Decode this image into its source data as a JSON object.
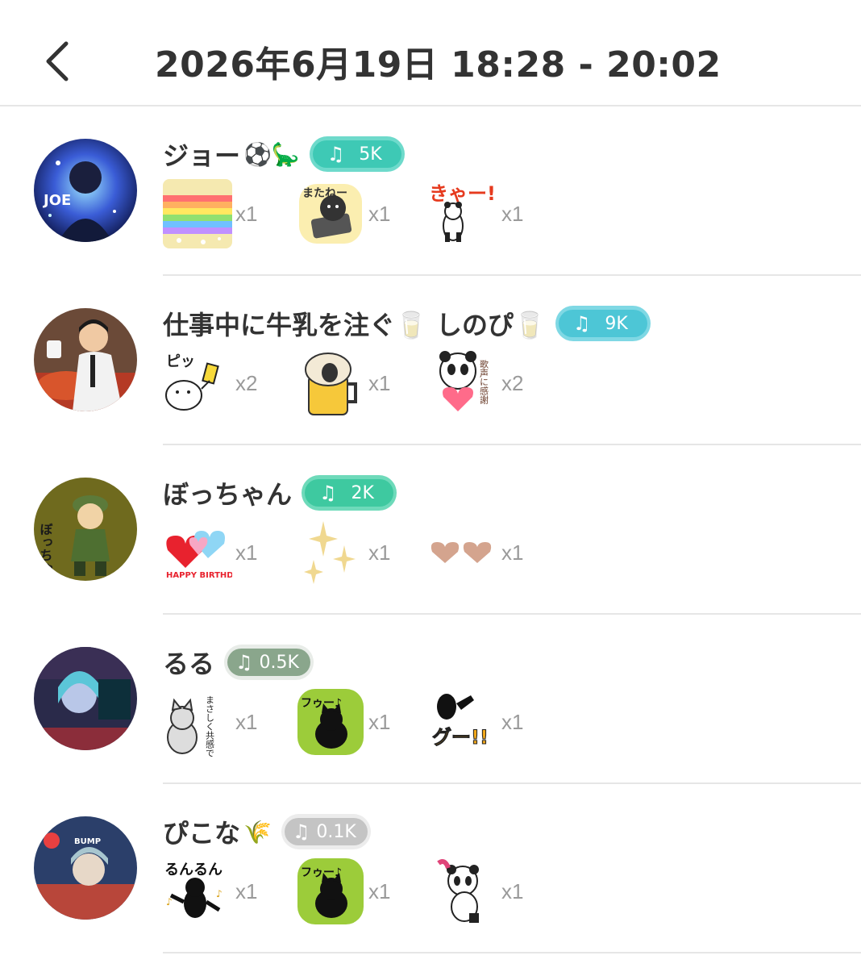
{
  "header": {
    "title": "2026年6月19日 18:28 - 20:02",
    "back_icon": "chevron-left-icon"
  },
  "rows": [
    {
      "name": "ジョー",
      "emoji": "⚽🦕",
      "badge": {
        "label": "5K",
        "icon": "music-note-icon",
        "color": "#3ec9b5",
        "outline": "#6edacb"
      },
      "gifts": [
        {
          "sticker": "rainbow-sticker",
          "count": "x1"
        },
        {
          "sticker": "bear-phone-matane-sticker",
          "count": "x1"
        },
        {
          "sticker": "panda-kyaa-sticker",
          "count": "x1",
          "text": "きゃー!"
        }
      ]
    },
    {
      "name": "仕事中に牛乳を注ぐ🥛 しのぴ🥛",
      "emoji": "",
      "badge": {
        "label": "9K",
        "icon": "music-note-icon",
        "color": "#4dc6d6",
        "outline": "#7fd8e4"
      },
      "gifts": [
        {
          "sticker": "dog-yellow-card-sticker",
          "count": "x2",
          "text": "ピッ"
        },
        {
          "sticker": "sheep-beer-sticker",
          "count": "x1"
        },
        {
          "sticker": "panda-heart-thanks-sticker",
          "count": "x2",
          "text": "歌声に感謝"
        }
      ]
    },
    {
      "name": "ぼっちゃん",
      "emoji": "",
      "badge": {
        "label": "2K",
        "icon": "music-note-icon",
        "color": "#3ec9a0",
        "outline": "#6edaba"
      },
      "gifts": [
        {
          "sticker": "happy-birthday-hearts-sticker",
          "count": "x1",
          "text": "HAPPY BIRTHDAY"
        },
        {
          "sticker": "sparkles-sticker",
          "count": "x1"
        },
        {
          "sticker": "two-hearts-sticker",
          "count": "x1"
        }
      ]
    },
    {
      "name": "るる",
      "emoji": "",
      "badge": {
        "label": "0.5K",
        "icon": "music-note-icon",
        "color": "#8aa68c",
        "outline": "#e8ece8"
      },
      "gifts": [
        {
          "sticker": "cat-masashiku-sticker",
          "count": "x1",
          "text": "まさしく共感です"
        },
        {
          "sticker": "black-cat-fuu-sticker",
          "count": "x1",
          "text": "フゥー♪"
        },
        {
          "sticker": "penguin-guu-sticker",
          "count": "x1",
          "text": "グー!!"
        }
      ]
    },
    {
      "name": "ぴこな",
      "emoji": "🌾",
      "badge": {
        "label": "0.1K",
        "icon": "music-note-icon",
        "color": "#c4c4c4",
        "outline": "#ececec"
      },
      "gifts": [
        {
          "sticker": "black-creature-runrun-sticker",
          "count": "x1",
          "text": "るんるん"
        },
        {
          "sticker": "black-cat-fuu-sticker",
          "count": "x1",
          "text": "フゥー♪"
        },
        {
          "sticker": "panda-dancing-sticker",
          "count": "x1"
        }
      ]
    }
  ]
}
